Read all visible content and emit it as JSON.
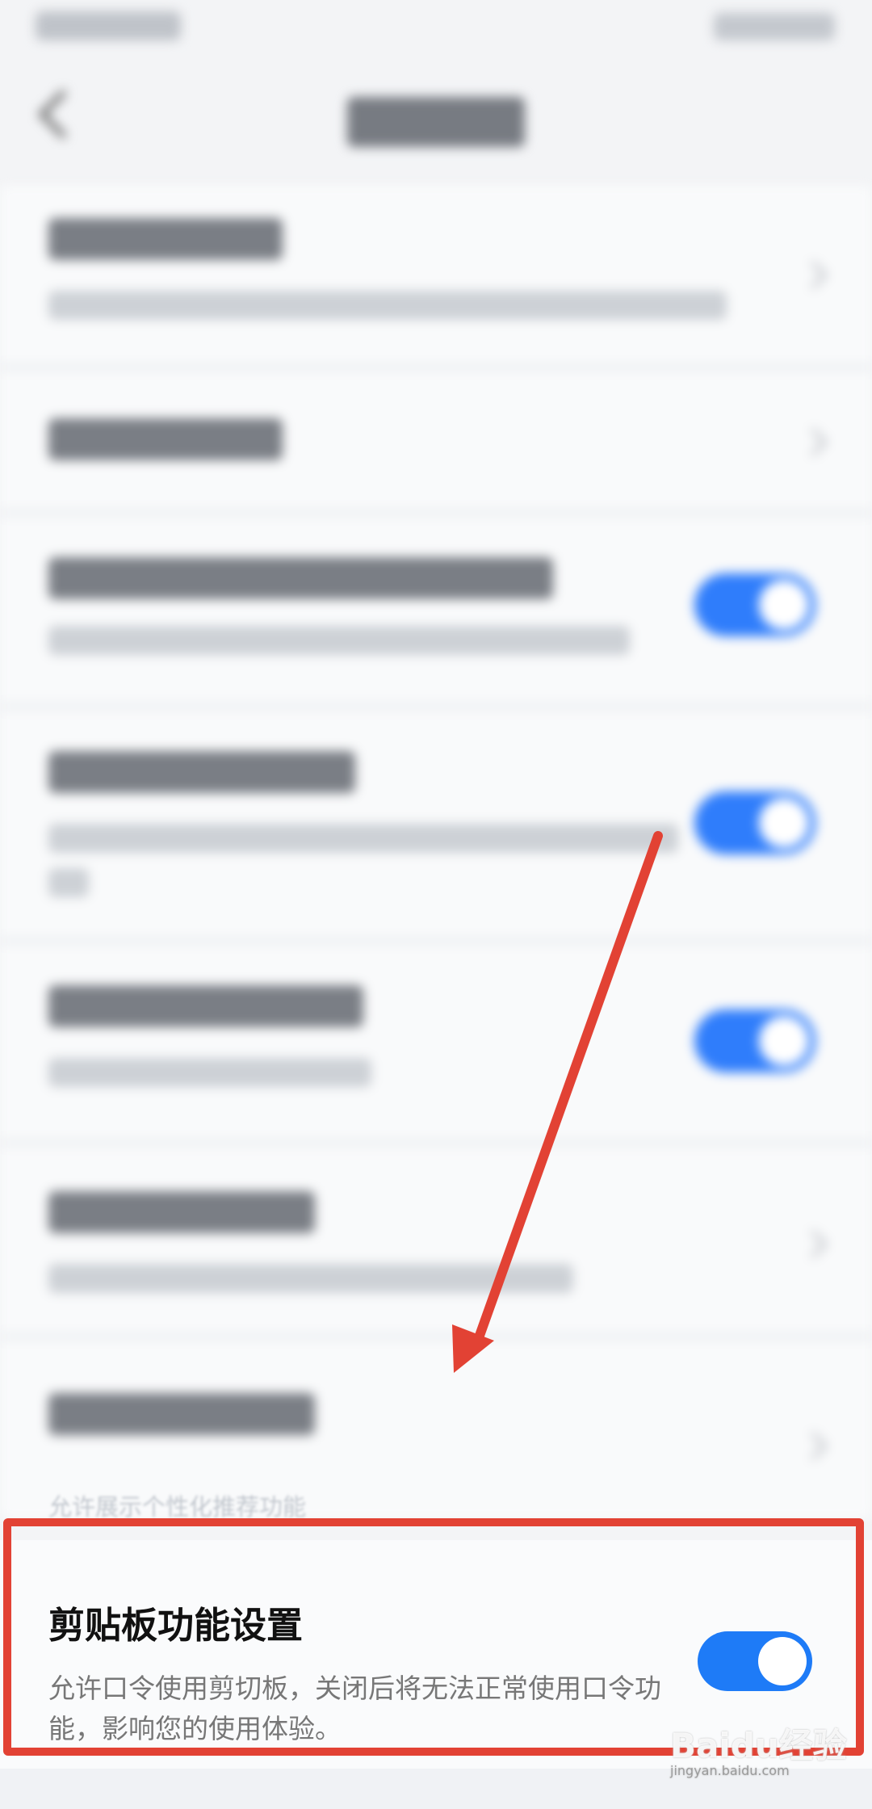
{
  "nav": {
    "back_icon": "back-arrow-icon"
  },
  "visible_hint": "允许展示个性化推荐功能",
  "clipboard": {
    "title": "剪贴板功能设置",
    "description": "允许口令使用剪切板，关闭后将无法正常使用口令功能，影响您的使用体验。",
    "enabled": true
  },
  "watermark": {
    "text": "Baidu经验",
    "sub": "jingyan.baidu.com"
  },
  "colors": {
    "accent": "#1e7bf7",
    "highlight": "#e24234"
  }
}
